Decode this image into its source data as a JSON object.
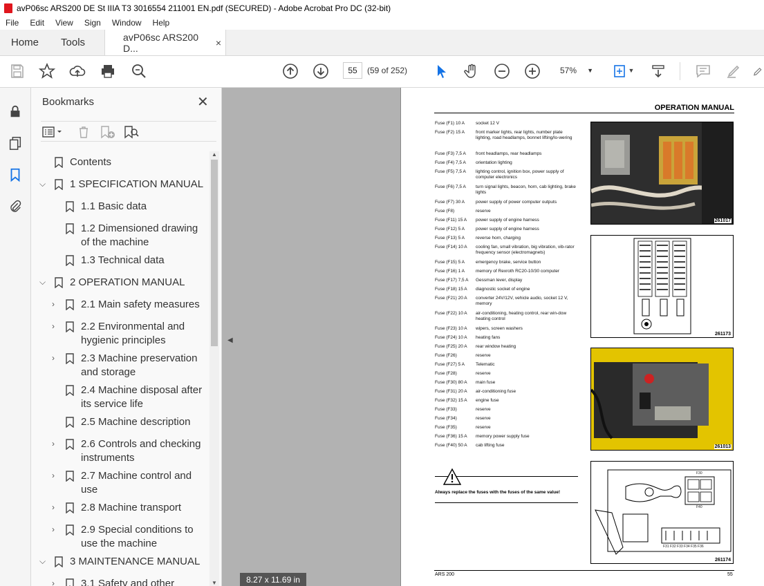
{
  "window": {
    "title": "avP06sc ARS200 DE St IIIA T3 3016554 211001 EN.pdf (SECURED) - Adobe Acrobat Pro DC (32-bit)"
  },
  "menu": [
    "File",
    "Edit",
    "View",
    "Sign",
    "Window",
    "Help"
  ],
  "tabs": {
    "home": "Home",
    "tools": "Tools",
    "doc": "avP06sc ARS200 D...",
    "close": "×"
  },
  "toolbar": {
    "page_value": "55",
    "page_count": "(59 of 252)",
    "zoom": "57%"
  },
  "bookmarks": {
    "title": "Bookmarks",
    "close": "✕",
    "items": [
      {
        "label": "Contents"
      },
      {
        "label": "1 SPECIFICATION MANUAL"
      },
      {
        "label": "1.1 Basic data"
      },
      {
        "label": "1.2 Dimensioned drawing",
        "label2": "of the machine"
      },
      {
        "label": "1.3 Technical data"
      },
      {
        "label": "2 OPERATION MANUAL"
      },
      {
        "label": "2.1 Main safety measures"
      },
      {
        "label": "2.2 Environmental and",
        "label2": "hygienic principles"
      },
      {
        "label": "2.3 Machine preservation",
        "label2": "and storage"
      },
      {
        "label": "2.4 Machine disposal after",
        "label2": "its service life"
      },
      {
        "label": "2.5 Machine description"
      },
      {
        "label": "2.6 Controls and checking",
        "label2": "instruments"
      },
      {
        "label": "2.7 Machine control and",
        "label2": "use"
      },
      {
        "label": "2.8 Machine transport"
      },
      {
        "label": "2.9 Special conditions to",
        "label2": "use the machine"
      },
      {
        "label": "3 MAINTENANCE MANUAL"
      },
      {
        "label": "3.1 Safety and other"
      }
    ]
  },
  "status": {
    "page_size": "8.27 x 11.69 in"
  },
  "page": {
    "header": "OPERATION MANUAL",
    "fuses": [
      {
        "l": "Fuse (F1) 10 A",
        "d": "socket 12 V"
      },
      {
        "l": "Fuse (F2) 15 A",
        "d": "front marker lights, rear lights, number plate lighting, road headlamps, bonnet lifting/lo-wering"
      },
      {
        "l": "Fuse (F3) 7,5 A",
        "d": "front headlamps, rear headlamps"
      },
      {
        "l": "Fuse (F4) 7,5 A",
        "d": "orientation lighting"
      },
      {
        "l": "Fuse (F5) 7,5 A",
        "d": "lighting control, ignition box, power supply of computer electronics"
      },
      {
        "l": "Fuse (F6) 7,5 A",
        "d": "turn signal lights, beacon, horn, cab lighting, brake lights"
      },
      {
        "l": "Fuse (F7) 30 A",
        "d": "power supply of power computer outputs"
      },
      {
        "l": "Fuse (F8)",
        "d": "reserve"
      },
      {
        "l": "Fuse (F11) 15 A",
        "d": "power supply of engine harness"
      },
      {
        "l": "Fuse (F12) 5 A",
        "d": "power supply of engine harness"
      },
      {
        "l": "Fuse (F13) 5 A",
        "d": "reverse horn, charging"
      },
      {
        "l": "Fuse (F14) 10 A",
        "d": "cooling fan, small vibration, big vibration, vib-rator frequency sensor (electromagnets)"
      },
      {
        "l": "Fuse (F15) 5 A",
        "d": "emergency brake, service button"
      },
      {
        "l": "Fuse (F16) 1 A",
        "d": "memory of Rexroth RC20-10/30 computer"
      },
      {
        "l": "Fuse (F17) 7,5 A",
        "d": "Gessman lever, display"
      },
      {
        "l": "Fuse (F18) 15 A",
        "d": "diagnostic socket of engine"
      },
      {
        "l": "Fuse (F21) 20 A",
        "d": "converter 24V/12V, vehicle audio, socket 12 V, memory"
      },
      {
        "l": "Fuse (F22) 10 A",
        "d": "air-conditioning, heating control, rear win-dow heating control"
      },
      {
        "l": "Fuse (F23) 10 A",
        "d": "wipers, screen washers"
      },
      {
        "l": "Fuse (F24) 10 A",
        "d": "heating fans"
      },
      {
        "l": "Fuse (F25) 20 A",
        "d": "rear window heating"
      },
      {
        "l": "Fuse (F26)",
        "d": "reserve"
      },
      {
        "l": "Fuse (F27) 5 A",
        "d": "Telematic"
      },
      {
        "l": "Fuse (F28)",
        "d": "reserve"
      },
      {
        "l": "Fuse (F30) 80 A",
        "d": "main fuse"
      },
      {
        "l": "Fuse (F31) 20 A",
        "d": "air-conditioning fuse"
      },
      {
        "l": "Fuse (F32) 15 A",
        "d": "engine fuse"
      },
      {
        "l": "Fuse (F33)",
        "d": "reserve"
      },
      {
        "l": "Fuse (F34)",
        "d": "reserve"
      },
      {
        "l": "Fuse (F35)",
        "d": "reserve"
      },
      {
        "l": "Fuse (F36) 15 A",
        "d": "memory power supply fuse"
      },
      {
        "l": "Fuse (F40) 50 A",
        "d": "cab lifting fuse"
      }
    ],
    "figures": [
      "261017",
      "261173",
      "261013",
      "261174"
    ],
    "diagram_labels": {
      "f30": "F30",
      "f40": "F40",
      "bottom": "F31 F32 F33 F34 F35 F36"
    },
    "warning": "Always replace the fuses with the fuses of the same value!",
    "footer_left": "ARS 200",
    "footer_right": "55"
  }
}
